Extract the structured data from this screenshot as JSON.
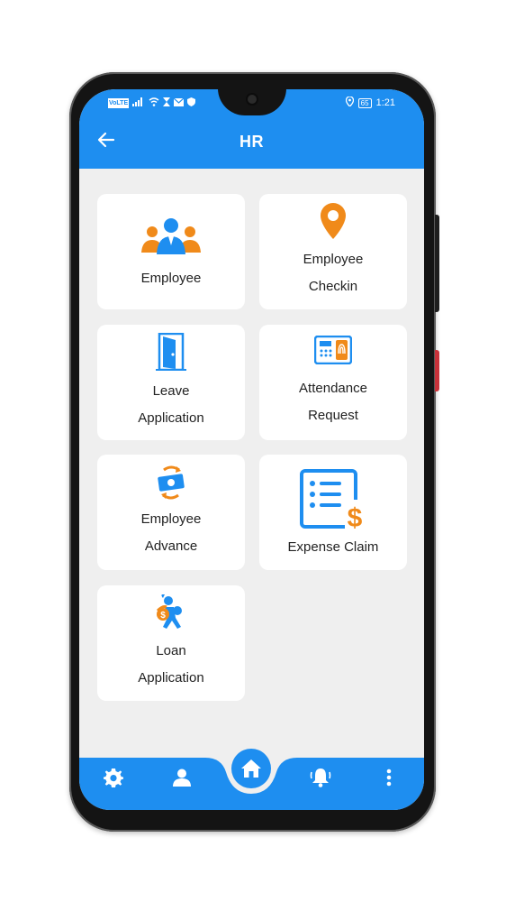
{
  "status_bar": {
    "left_icons": [
      "volte-icon",
      "signal-icon",
      "wifi-icon",
      "hourglass-icon",
      "mail-icon",
      "shield-icon"
    ],
    "volte_label": "VoLTE",
    "battery": "65",
    "time": "1:21"
  },
  "header": {
    "title": "HR"
  },
  "menu": [
    {
      "line1": "Employee",
      "line2": ""
    },
    {
      "line1": "Employee",
      "line2": "Checkin"
    },
    {
      "line1": "Leave",
      "line2": "Application"
    },
    {
      "line1": "Attendance",
      "line2": "Request"
    },
    {
      "line1": "Employee",
      "line2": "Advance"
    },
    {
      "line1": "",
      "line2": "Expense Claim"
    },
    {
      "line1": "Loan",
      "line2": "Application"
    }
  ],
  "bottom_nav": {
    "items": [
      "settings-icon",
      "profile-icon",
      "home-icon",
      "notifications-icon",
      "more-icon"
    ]
  },
  "colors": {
    "primary": "#1e8ef0",
    "accent": "#f08a1a",
    "background": "#efefef",
    "card": "#ffffff"
  }
}
